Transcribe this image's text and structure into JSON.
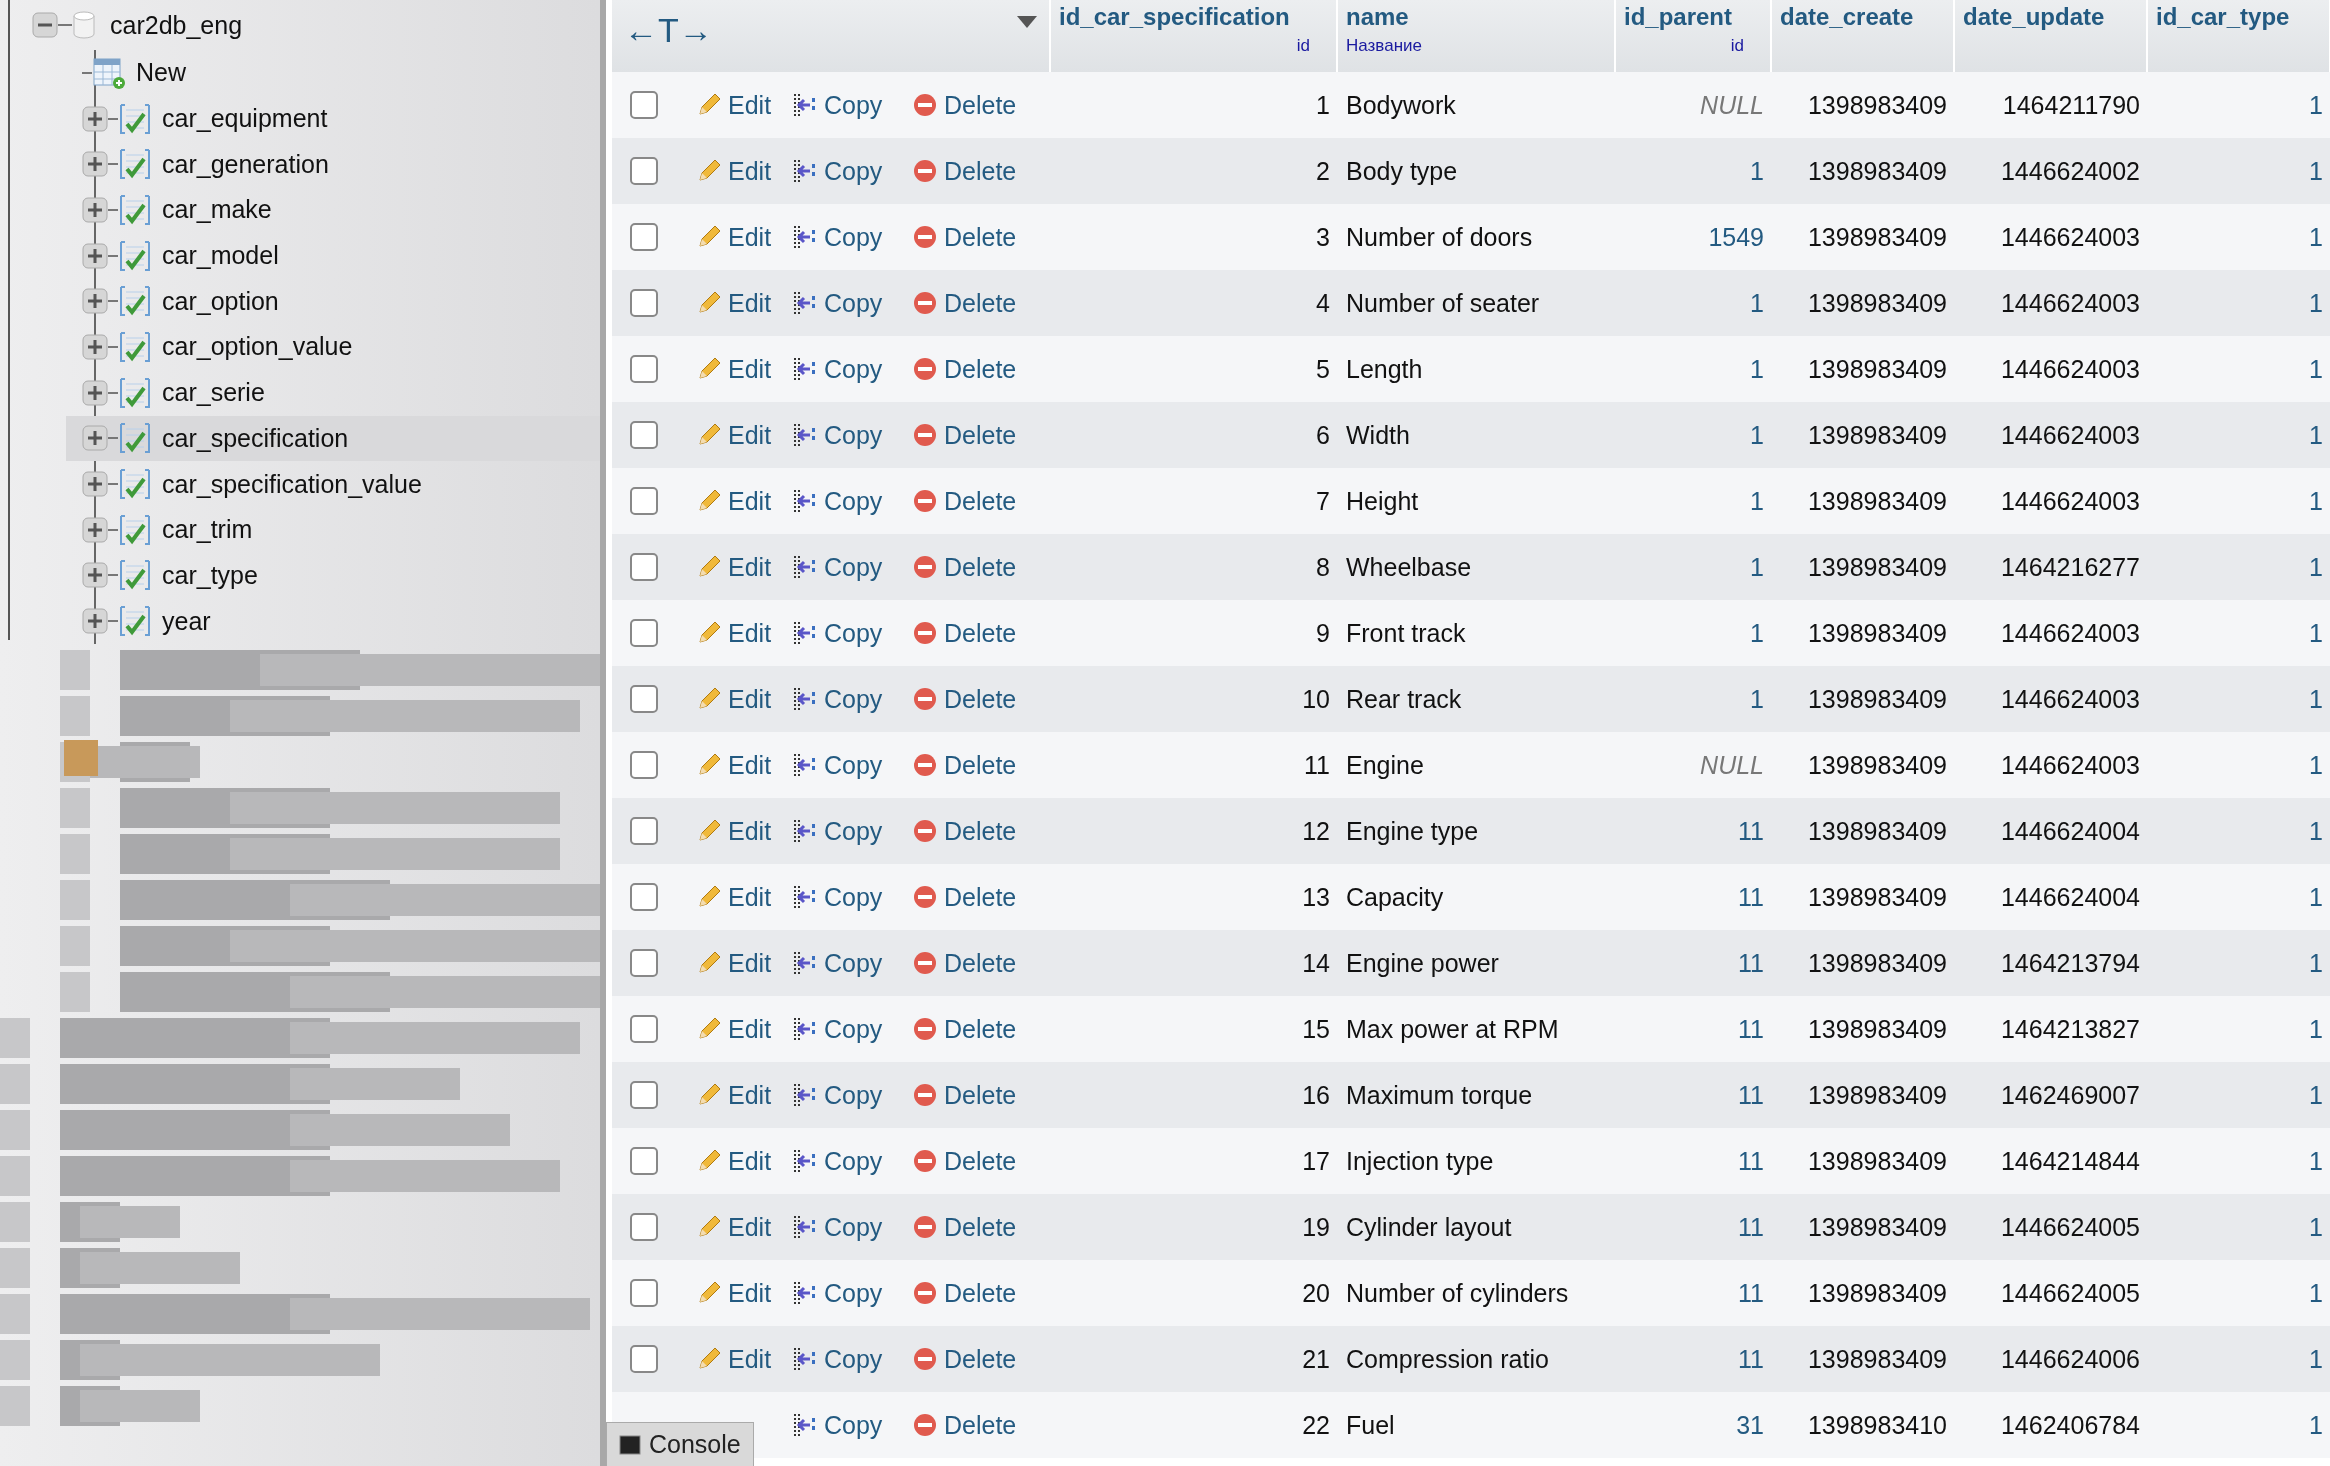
{
  "sidebar": {
    "database": {
      "label": "car2db_eng",
      "expanded": true,
      "children": [
        {
          "kind": "new",
          "label": "New"
        },
        {
          "kind": "table",
          "label": "car_equipment",
          "expanded": false,
          "selected": false
        },
        {
          "kind": "table",
          "label": "car_generation",
          "expanded": false,
          "selected": false
        },
        {
          "kind": "table",
          "label": "car_make",
          "expanded": false,
          "selected": false
        },
        {
          "kind": "table",
          "label": "car_model",
          "expanded": false,
          "selected": false
        },
        {
          "kind": "table",
          "label": "car_option",
          "expanded": false,
          "selected": false
        },
        {
          "kind": "table",
          "label": "car_option_value",
          "expanded": false,
          "selected": false
        },
        {
          "kind": "table",
          "label": "car_serie",
          "expanded": false,
          "selected": false
        },
        {
          "kind": "table",
          "label": "car_specification",
          "expanded": false,
          "selected": true
        },
        {
          "kind": "table",
          "label": "car_specification_value",
          "expanded": false,
          "selected": false
        },
        {
          "kind": "table",
          "label": "car_trim",
          "expanded": false,
          "selected": false
        },
        {
          "kind": "table",
          "label": "car_type",
          "expanded": false,
          "selected": false
        },
        {
          "kind": "table",
          "label": "year",
          "expanded": false,
          "selected": false
        }
      ]
    }
  },
  "table": {
    "column_toggle": "←T→",
    "columns": [
      {
        "label": "id_car_specification",
        "comment": "id"
      },
      {
        "label": "name",
        "comment": "Название"
      },
      {
        "label": "id_parent",
        "comment": "id"
      },
      {
        "label": "date_create"
      },
      {
        "label": "date_update"
      },
      {
        "label": "id_car_type"
      }
    ],
    "rows": [
      {
        "checked": false,
        "actions": [
          {
            "kind": "edit",
            "label": "Edit"
          },
          {
            "kind": "copy",
            "label": "Copy"
          },
          {
            "kind": "delete",
            "label": "Delete"
          }
        ],
        "id": "1",
        "name": "Bodywork",
        "id_parent": "NULL",
        "is_null": true,
        "date_create": "1398983409",
        "date_update": "1464211790",
        "id_car_type": "1"
      },
      {
        "checked": false,
        "actions": [
          {
            "kind": "edit",
            "label": "Edit"
          },
          {
            "kind": "copy",
            "label": "Copy"
          },
          {
            "kind": "delete",
            "label": "Delete"
          }
        ],
        "id": "2",
        "name": "Body type",
        "id_parent": "1",
        "is_null": false,
        "date_create": "1398983409",
        "date_update": "1446624002",
        "id_car_type": "1"
      },
      {
        "checked": false,
        "actions": [
          {
            "kind": "edit",
            "label": "Edit"
          },
          {
            "kind": "copy",
            "label": "Copy"
          },
          {
            "kind": "delete",
            "label": "Delete"
          }
        ],
        "id": "3",
        "name": "Number of doors",
        "id_parent": "1549",
        "is_null": false,
        "date_create": "1398983409",
        "date_update": "1446624003",
        "id_car_type": "1"
      },
      {
        "checked": false,
        "actions": [
          {
            "kind": "edit",
            "label": "Edit"
          },
          {
            "kind": "copy",
            "label": "Copy"
          },
          {
            "kind": "delete",
            "label": "Delete"
          }
        ],
        "id": "4",
        "name": "Number of seater",
        "id_parent": "1",
        "is_null": false,
        "date_create": "1398983409",
        "date_update": "1446624003",
        "id_car_type": "1"
      },
      {
        "checked": false,
        "actions": [
          {
            "kind": "edit",
            "label": "Edit"
          },
          {
            "kind": "copy",
            "label": "Copy"
          },
          {
            "kind": "delete",
            "label": "Delete"
          }
        ],
        "id": "5",
        "name": "Length",
        "id_parent": "1",
        "is_null": false,
        "date_create": "1398983409",
        "date_update": "1446624003",
        "id_car_type": "1"
      },
      {
        "checked": false,
        "actions": [
          {
            "kind": "edit",
            "label": "Edit"
          },
          {
            "kind": "copy",
            "label": "Copy"
          },
          {
            "kind": "delete",
            "label": "Delete"
          }
        ],
        "id": "6",
        "name": "Width",
        "id_parent": "1",
        "is_null": false,
        "date_create": "1398983409",
        "date_update": "1446624003",
        "id_car_type": "1"
      },
      {
        "checked": false,
        "actions": [
          {
            "kind": "edit",
            "label": "Edit"
          },
          {
            "kind": "copy",
            "label": "Copy"
          },
          {
            "kind": "delete",
            "label": "Delete"
          }
        ],
        "id": "7",
        "name": "Height",
        "id_parent": "1",
        "is_null": false,
        "date_create": "1398983409",
        "date_update": "1446624003",
        "id_car_type": "1"
      },
      {
        "checked": false,
        "actions": [
          {
            "kind": "edit",
            "label": "Edit"
          },
          {
            "kind": "copy",
            "label": "Copy"
          },
          {
            "kind": "delete",
            "label": "Delete"
          }
        ],
        "id": "8",
        "name": "Wheelbase",
        "id_parent": "1",
        "is_null": false,
        "date_create": "1398983409",
        "date_update": "1464216277",
        "id_car_type": "1"
      },
      {
        "checked": false,
        "actions": [
          {
            "kind": "edit",
            "label": "Edit"
          },
          {
            "kind": "copy",
            "label": "Copy"
          },
          {
            "kind": "delete",
            "label": "Delete"
          }
        ],
        "id": "9",
        "name": "Front track",
        "id_parent": "1",
        "is_null": false,
        "date_create": "1398983409",
        "date_update": "1446624003",
        "id_car_type": "1"
      },
      {
        "checked": false,
        "actions": [
          {
            "kind": "edit",
            "label": "Edit"
          },
          {
            "kind": "copy",
            "label": "Copy"
          },
          {
            "kind": "delete",
            "label": "Delete"
          }
        ],
        "id": "10",
        "name": "Rear track",
        "id_parent": "1",
        "is_null": false,
        "date_create": "1398983409",
        "date_update": "1446624003",
        "id_car_type": "1"
      },
      {
        "checked": false,
        "actions": [
          {
            "kind": "edit",
            "label": "Edit"
          },
          {
            "kind": "copy",
            "label": "Copy"
          },
          {
            "kind": "delete",
            "label": "Delete"
          }
        ],
        "id": "11",
        "name": "Engine",
        "id_parent": "NULL",
        "is_null": true,
        "date_create": "1398983409",
        "date_update": "1446624003",
        "id_car_type": "1"
      },
      {
        "checked": false,
        "actions": [
          {
            "kind": "edit",
            "label": "Edit"
          },
          {
            "kind": "copy",
            "label": "Copy"
          },
          {
            "kind": "delete",
            "label": "Delete"
          }
        ],
        "id": "12",
        "name": "Engine type",
        "id_parent": "11",
        "is_null": false,
        "date_create": "1398983409",
        "date_update": "1446624004",
        "id_car_type": "1"
      },
      {
        "checked": false,
        "actions": [
          {
            "kind": "edit",
            "label": "Edit"
          },
          {
            "kind": "copy",
            "label": "Copy"
          },
          {
            "kind": "delete",
            "label": "Delete"
          }
        ],
        "id": "13",
        "name": "Capacity",
        "id_parent": "11",
        "is_null": false,
        "date_create": "1398983409",
        "date_update": "1446624004",
        "id_car_type": "1"
      },
      {
        "checked": false,
        "actions": [
          {
            "kind": "edit",
            "label": "Edit"
          },
          {
            "kind": "copy",
            "label": "Copy"
          },
          {
            "kind": "delete",
            "label": "Delete"
          }
        ],
        "id": "14",
        "name": "Engine power",
        "id_parent": "11",
        "is_null": false,
        "date_create": "1398983409",
        "date_update": "1464213794",
        "id_car_type": "1"
      },
      {
        "checked": false,
        "actions": [
          {
            "kind": "edit",
            "label": "Edit"
          },
          {
            "kind": "copy",
            "label": "Copy"
          },
          {
            "kind": "delete",
            "label": "Delete"
          }
        ],
        "id": "15",
        "name": "Max power at RPM",
        "id_parent": "11",
        "is_null": false,
        "date_create": "1398983409",
        "date_update": "1464213827",
        "id_car_type": "1"
      },
      {
        "checked": false,
        "actions": [
          {
            "kind": "edit",
            "label": "Edit"
          },
          {
            "kind": "copy",
            "label": "Copy"
          },
          {
            "kind": "delete",
            "label": "Delete"
          }
        ],
        "id": "16",
        "name": "Maximum torque",
        "id_parent": "11",
        "is_null": false,
        "date_create": "1398983409",
        "date_update": "1462469007",
        "id_car_type": "1"
      },
      {
        "checked": false,
        "actions": [
          {
            "kind": "edit",
            "label": "Edit"
          },
          {
            "kind": "copy",
            "label": "Copy"
          },
          {
            "kind": "delete",
            "label": "Delete"
          }
        ],
        "id": "17",
        "name": "Injection type",
        "id_parent": "11",
        "is_null": false,
        "date_create": "1398983409",
        "date_update": "1464214844",
        "id_car_type": "1"
      },
      {
        "checked": false,
        "actions": [
          {
            "kind": "edit",
            "label": "Edit"
          },
          {
            "kind": "copy",
            "label": "Copy"
          },
          {
            "kind": "delete",
            "label": "Delete"
          }
        ],
        "id": "19",
        "name": "Cylinder layout",
        "id_parent": "11",
        "is_null": false,
        "date_create": "1398983409",
        "date_update": "1446624005",
        "id_car_type": "1"
      },
      {
        "checked": false,
        "actions": [
          {
            "kind": "edit",
            "label": "Edit"
          },
          {
            "kind": "copy",
            "label": "Copy"
          },
          {
            "kind": "delete",
            "label": "Delete"
          }
        ],
        "id": "20",
        "name": "Number of cylinders",
        "id_parent": "11",
        "is_null": false,
        "date_create": "1398983409",
        "date_update": "1446624005",
        "id_car_type": "1"
      },
      {
        "checked": false,
        "actions": [
          {
            "kind": "edit",
            "label": "Edit"
          },
          {
            "kind": "copy",
            "label": "Copy"
          },
          {
            "kind": "delete",
            "label": "Delete"
          }
        ],
        "id": "21",
        "name": "Compression ratio",
        "id_parent": "11",
        "is_null": false,
        "date_create": "1398983409",
        "date_update": "1446624006",
        "id_car_type": "1"
      },
      {
        "actions": [
          {
            "kind": "copy",
            "label": "Copy"
          },
          {
            "kind": "delete",
            "label": "Delete"
          }
        ],
        "id": "22",
        "name": "Fuel",
        "id_parent": "31",
        "is_null": false,
        "date_create": "1398983410",
        "date_update": "1462406784",
        "id_car_type": "1"
      }
    ]
  },
  "console": {
    "label": "Console"
  }
}
